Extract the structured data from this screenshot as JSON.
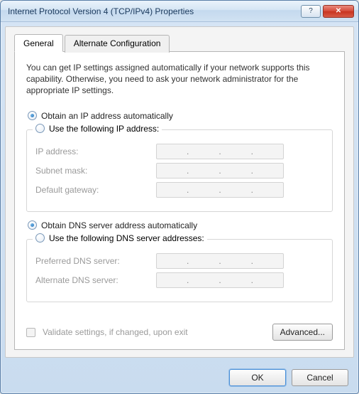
{
  "window": {
    "title": "Internet Protocol Version 4 (TCP/IPv4) Properties"
  },
  "tabs": {
    "general": "General",
    "alternate": "Alternate Configuration"
  },
  "intro": "You can get IP settings assigned automatically if your network supports this capability. Otherwise, you need to ask your network administrator for the appropriate IP settings.",
  "ip": {
    "auto_label": "Obtain an IP address automatically",
    "manual_label": "Use the following IP address:",
    "fields": {
      "ip_address": "IP address:",
      "subnet_mask": "Subnet mask:",
      "default_gateway": "Default gateway:"
    }
  },
  "dns": {
    "auto_label": "Obtain DNS server address automatically",
    "manual_label": "Use the following DNS server addresses:",
    "fields": {
      "preferred": "Preferred DNS server:",
      "alternate": "Alternate DNS server:"
    }
  },
  "validate_label": "Validate settings, if changed, upon exit",
  "buttons": {
    "advanced": "Advanced...",
    "ok": "OK",
    "cancel": "Cancel"
  }
}
